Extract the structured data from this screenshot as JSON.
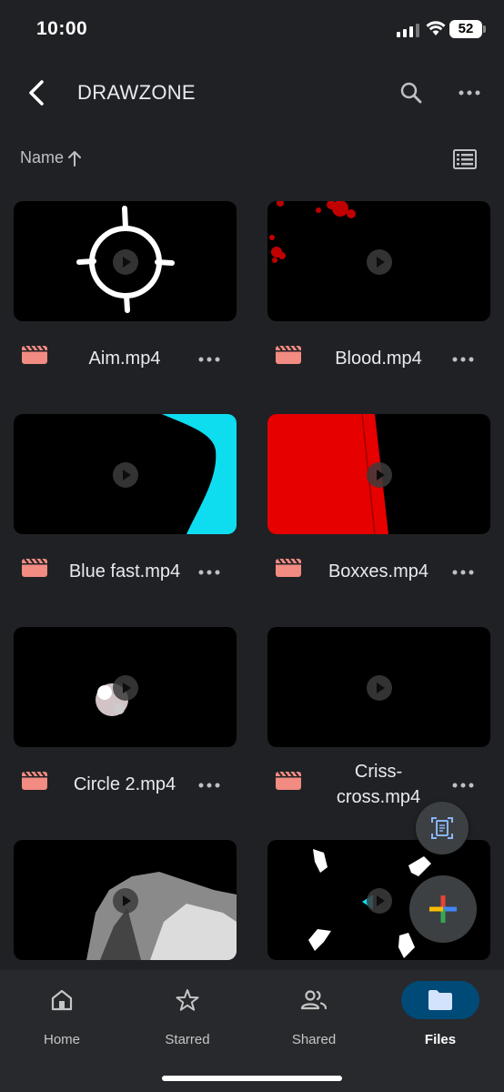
{
  "status_bar": {
    "time": "10:00",
    "battery": "52"
  },
  "header": {
    "title": "DRAWZONE"
  },
  "sort": {
    "label": "Name"
  },
  "files": [
    {
      "name": "Aim.mp4"
    },
    {
      "name": "Blood.mp4"
    },
    {
      "name": "Blue fast.mp4"
    },
    {
      "name": "Boxxes.mp4"
    },
    {
      "name": "Circle 2.mp4"
    },
    {
      "name": "Criss-cross.mp4"
    },
    {
      "name": ""
    },
    {
      "name": ""
    }
  ],
  "colors": {
    "file_icon": "#f28b82",
    "accent_blue": "#0eddf0",
    "accent_red": "#e60000",
    "nav_active": "#004a77"
  },
  "nav": {
    "items": [
      {
        "label": "Home",
        "icon": "home-icon"
      },
      {
        "label": "Starred",
        "icon": "star-icon"
      },
      {
        "label": "Shared",
        "icon": "people-icon"
      },
      {
        "label": "Files",
        "icon": "folder-icon",
        "active": true
      }
    ]
  }
}
